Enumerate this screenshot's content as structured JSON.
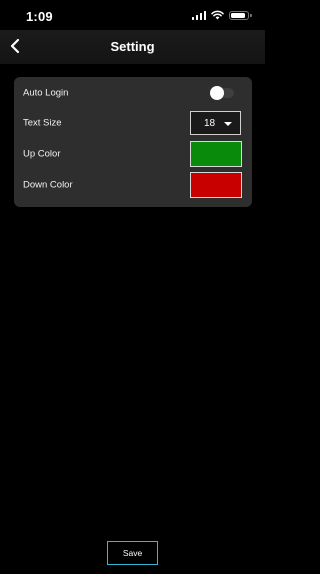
{
  "status_bar": {
    "time": "1:09",
    "icons": [
      "signal-icon",
      "wifi-icon",
      "battery-icon"
    ]
  },
  "nav": {
    "title": "Setting",
    "back_icon": "chevron-left-icon"
  },
  "settings": {
    "auto_login": {
      "label": "Auto Login",
      "enabled": false
    },
    "text_size": {
      "label": "Text Size",
      "value": "18"
    },
    "up_color": {
      "label": "Up Color",
      "color": "#0a8a0a"
    },
    "down_color": {
      "label": "Down Color",
      "color": "#c90000"
    }
  },
  "save_label": "Save",
  "colors": {
    "background": "#000000",
    "panel": "#2e2e2e",
    "save_border": "#35b8d8"
  }
}
